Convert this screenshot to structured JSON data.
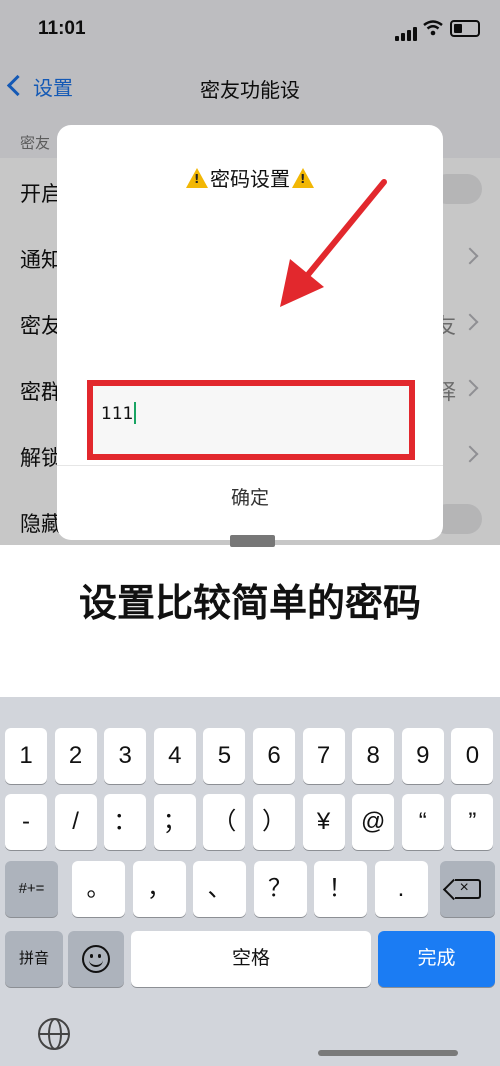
{
  "status": {
    "time": "11:01"
  },
  "nav": {
    "back_label": "设置",
    "title": "密友功能设"
  },
  "settings": {
    "section_label": "密友",
    "rows": [
      {
        "label": "开启",
        "control": "toggle"
      },
      {
        "label": "通知",
        "control": "arrow"
      },
      {
        "label": "密友",
        "value": "友",
        "control": "arrow"
      },
      {
        "label": "密群",
        "value": "择",
        "control": "arrow"
      },
      {
        "label": "解锁",
        "control": "arrow"
      },
      {
        "label": "隐藏",
        "control": "toggle"
      }
    ]
  },
  "dialog": {
    "title": "密码设置",
    "title_icon": "warning-icon",
    "password_value": "111",
    "confirm_label": "确定",
    "highlight_color": "#e2282d"
  },
  "caption": "设置比较简单的密码",
  "keyboard": {
    "row1": [
      "1",
      "2",
      "3",
      "4",
      "5",
      "6",
      "7",
      "8",
      "9",
      "0"
    ],
    "row2": [
      "-",
      "/",
      "：",
      "；",
      "（",
      "）",
      "¥",
      "@",
      "“",
      "”"
    ],
    "row3_left": "#+=",
    "row3": [
      "。",
      "，",
      "、",
      "？",
      "！",
      "."
    ],
    "pinyin_label": "拼音",
    "space_label": "空格",
    "done_label": "完成",
    "accent_color": "#1b7cf3"
  }
}
